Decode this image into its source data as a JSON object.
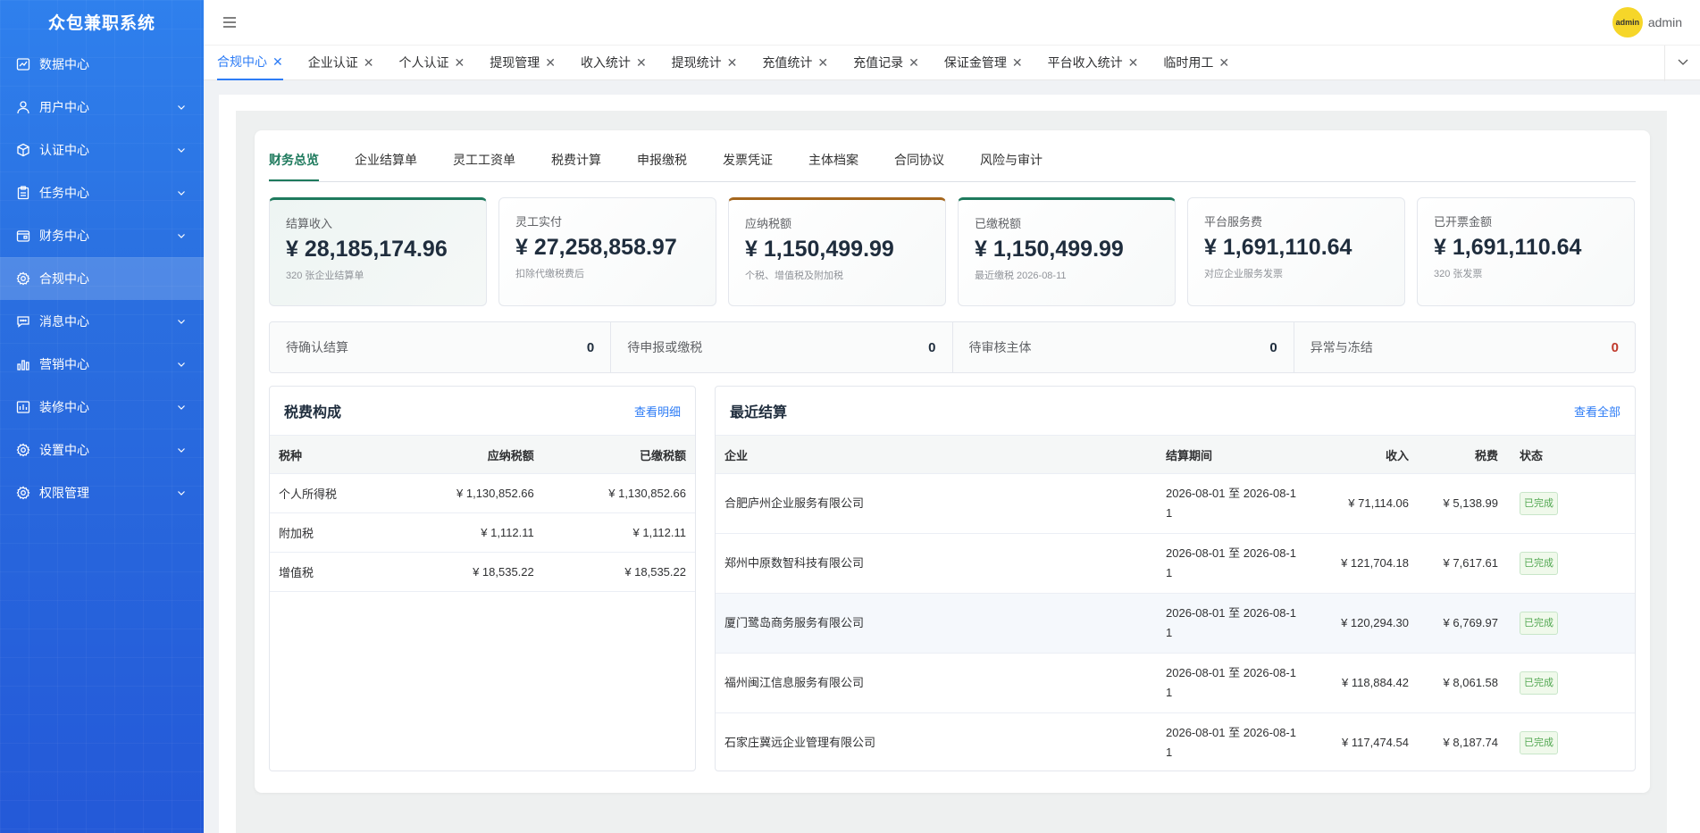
{
  "app": {
    "title": "众包兼职系统"
  },
  "sidebar": {
    "items": [
      {
        "label": "数据中心",
        "icon": "chart-line-icon",
        "expandable": false,
        "active": false
      },
      {
        "label": "用户中心",
        "icon": "user-icon",
        "expandable": true,
        "active": false
      },
      {
        "label": "认证中心",
        "icon": "cube-icon",
        "expandable": true,
        "active": false
      },
      {
        "label": "任务中心",
        "icon": "clipboard-icon",
        "expandable": true,
        "active": false
      },
      {
        "label": "财务中心",
        "icon": "wallet-icon",
        "expandable": true,
        "active": false
      },
      {
        "label": "合规中心",
        "icon": "gear-icon",
        "expandable": false,
        "active": true
      },
      {
        "label": "消息中心",
        "icon": "chat-icon",
        "expandable": true,
        "active": false
      },
      {
        "label": "营销中心",
        "icon": "bar-chart-icon",
        "expandable": true,
        "active": false
      },
      {
        "label": "装修中心",
        "icon": "layout-icon",
        "expandable": true,
        "active": false
      },
      {
        "label": "设置中心",
        "icon": "gear-icon",
        "expandable": true,
        "active": false
      },
      {
        "label": "权限管理",
        "icon": "gear-icon",
        "expandable": true,
        "active": false
      }
    ]
  },
  "header": {
    "user_name": "admin",
    "avatar_text": "admin"
  },
  "tags": [
    {
      "label": "合规中心",
      "active": true
    },
    {
      "label": "企业认证",
      "active": false
    },
    {
      "label": "个人认证",
      "active": false
    },
    {
      "label": "提现管理",
      "active": false
    },
    {
      "label": "收入统计",
      "active": false
    },
    {
      "label": "提现统计",
      "active": false
    },
    {
      "label": "充值统计",
      "active": false
    },
    {
      "label": "充值记录",
      "active": false
    },
    {
      "label": "保证金管理",
      "active": false
    },
    {
      "label": "平台收入统计",
      "active": false
    },
    {
      "label": "临时用工",
      "active": false
    }
  ],
  "subtabs": [
    {
      "label": "财务总览",
      "active": true
    },
    {
      "label": "企业结算单",
      "active": false
    },
    {
      "label": "灵工工资单",
      "active": false
    },
    {
      "label": "税费计算",
      "active": false
    },
    {
      "label": "申报缴税",
      "active": false
    },
    {
      "label": "发票凭证",
      "active": false
    },
    {
      "label": "主体档案",
      "active": false
    },
    {
      "label": "合同协议",
      "active": false
    },
    {
      "label": "风险与审计",
      "active": false
    }
  ],
  "stats": [
    {
      "label": "结算收入",
      "value": "¥ 28,185,174.96",
      "sub": "320 张企业结算单"
    },
    {
      "label": "灵工实付",
      "value": "¥ 27,258,858.97",
      "sub": "扣除代缴税费后"
    },
    {
      "label": "应纳税额",
      "value": "¥ 1,150,499.99",
      "sub": "个税、增值税及附加税"
    },
    {
      "label": "已缴税额",
      "value": "¥ 1,150,499.99",
      "sub": "最近缴税 2026-08-11"
    },
    {
      "label": "平台服务费",
      "value": "¥ 1,691,110.64",
      "sub": "对应企业服务发票"
    },
    {
      "label": "已开票金额",
      "value": "¥ 1,691,110.64",
      "sub": "320 张发票"
    }
  ],
  "pending": [
    {
      "label": "待确认结算",
      "count": "0"
    },
    {
      "label": "待申报或缴税",
      "count": "0"
    },
    {
      "label": "待审核主体",
      "count": "0"
    },
    {
      "label": "异常与冻结",
      "count": "0"
    }
  ],
  "tax": {
    "title": "税费构成",
    "link": "查看明细",
    "headers": {
      "type": "税种",
      "due": "应纳税额",
      "paid": "已缴税额"
    },
    "rows": [
      {
        "type": "个人所得税",
        "due": "¥ 1,130,852.66",
        "paid": "¥ 1,130,852.66"
      },
      {
        "type": "附加税",
        "due": "¥ 1,112.11",
        "paid": "¥ 1,112.11"
      },
      {
        "type": "增值税",
        "due": "¥ 18,535.22",
        "paid": "¥ 18,535.22"
      }
    ]
  },
  "recent": {
    "title": "最近结算",
    "link": "查看全部",
    "headers": {
      "company": "企业",
      "period": "结算期间",
      "income": "收入",
      "tax": "税费",
      "status": "状态"
    },
    "rows": [
      {
        "company": "合肥庐州企业服务有限公司",
        "period1": "2026-08-01 至 2026-08-1",
        "period2": "1",
        "income": "¥ 71,114.06",
        "tax": "¥ 5,138.99",
        "status": "已完成"
      },
      {
        "company": "郑州中原数智科技有限公司",
        "period1": "2026-08-01 至 2026-08-1",
        "period2": "1",
        "income": "¥ 121,704.18",
        "tax": "¥ 7,617.61",
        "status": "已完成"
      },
      {
        "company": "厦门鹭岛商务服务有限公司",
        "period1": "2026-08-01 至 2026-08-1",
        "period2": "1",
        "income": "¥ 120,294.30",
        "tax": "¥ 6,769.97",
        "status": "已完成"
      },
      {
        "company": "福州闽江信息服务有限公司",
        "period1": "2026-08-01 至 2026-08-1",
        "period2": "1",
        "income": "¥ 118,884.42",
        "tax": "¥ 8,061.58",
        "status": "已完成"
      },
      {
        "company": "石家庄冀远企业管理有限公司",
        "period1": "2026-08-01 至 2026-08-1",
        "period2": "1",
        "income": "¥ 117,474.54",
        "tax": "¥ 8,187.74",
        "status": "已完成"
      }
    ]
  },
  "colors": {
    "accent": "#2d7cf6",
    "green": "#1e7a5d",
    "orange": "#a5661d"
  }
}
